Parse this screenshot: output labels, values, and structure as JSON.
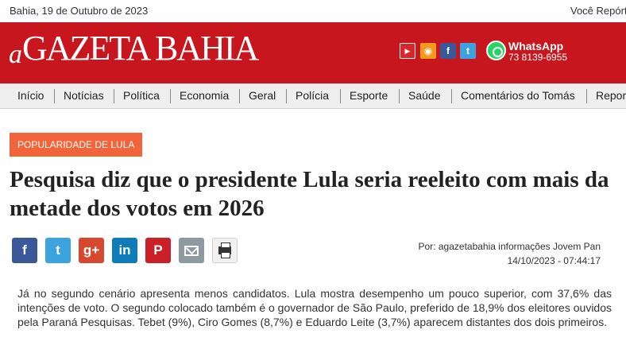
{
  "topbar": {
    "date": "Bahia, 19 de Outubro de 2023",
    "reporter": "Você Repórter"
  },
  "masthead": {
    "logo_prefix": "a",
    "logo_name": "GAZETA BAHIA",
    "brand_color": "#c8161e",
    "social_icons": [
      "youtube-icon",
      "rss-icon",
      "facebook-icon",
      "twitter-icon"
    ],
    "whatsapp": {
      "label": "WhatsApp",
      "phone": "73 8139-6955"
    }
  },
  "nav": {
    "items": [
      "Início",
      "Notícias",
      "Política",
      "Economia",
      "Geral",
      "Polícia",
      "Esporte",
      "Saúde",
      "Comentários do Tomás",
      "Reportagem"
    ]
  },
  "article": {
    "category": "POPULARIDADE DE LULA",
    "category_color": "#f2653a",
    "title": "Pesquisa diz que o presidente Lula seria reeleito com mais da metade dos votos em 2026",
    "share_icons": [
      "facebook-icon",
      "twitter-icon",
      "google-plus-icon",
      "linkedin-icon",
      "pinterest-icon",
      "email-icon",
      "print-icon"
    ],
    "byline": "Por: agazetabahia informações Jovem Pan",
    "datetime": "14/10/2023 - 07:44:17",
    "body": "Já no segundo cenário apresenta menos candidatos. Lula mostra desempenho um pouco superior, com 37,6% das intenções de voto. O segundo colocado também é o governador de São Paulo, preferido de 18,9% dos eleitores ouvidos pela Paraná Pesquisas. Tebet (9%), Ciro Gomes (8,7%) e Eduardo Leite (3,7%) aparecem distantes dos dois primeiros."
  }
}
